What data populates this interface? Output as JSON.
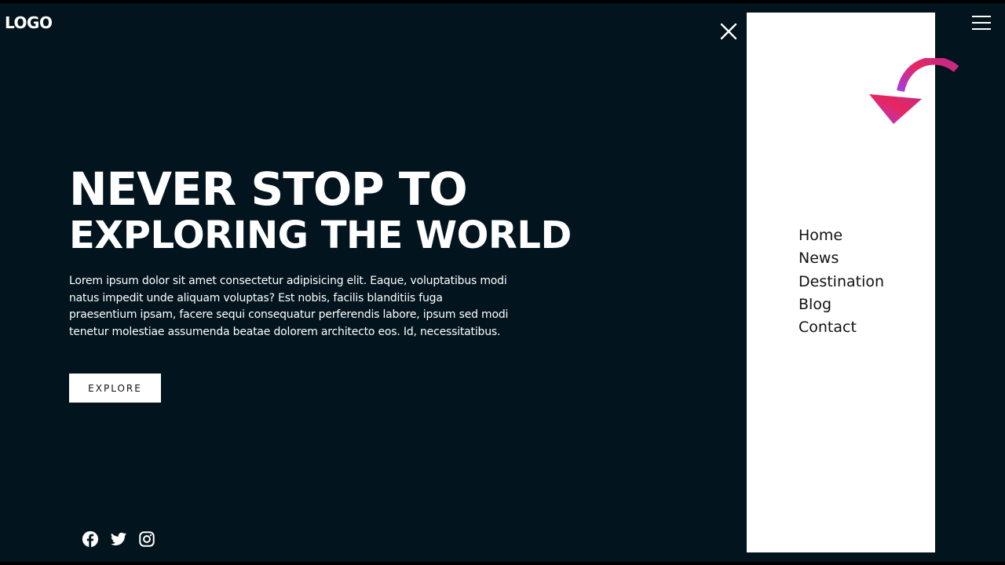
{
  "header": {
    "logo": "LOGO"
  },
  "hero": {
    "title_line1": "NEVER STOP TO",
    "title_line2": "EXPLORING THE WORLD",
    "description": "Lorem ipsum dolor sit amet consectetur adipisicing elit. Eaque, voluptatibus modi natus impedit unde aliquam voluptas? Est nobis, facilis blanditiis fuga praesentium ipsam, facere sequi consequatur perferendis labore, ipsum sed modi tenetur molestiae assumenda beatae dolorem architecto eos. Id, necessitatibus.",
    "cta_label": "EXPLORE"
  },
  "social": [
    {
      "icon": "facebook-icon"
    },
    {
      "icon": "twitter-icon"
    },
    {
      "icon": "instagram-icon"
    }
  ],
  "menu": {
    "items": [
      {
        "label": "Home"
      },
      {
        "label": "News"
      },
      {
        "label": "Destination"
      },
      {
        "label": "Blog"
      },
      {
        "label": "Contact"
      }
    ],
    "close_icon": "close-icon",
    "toggle_icon": "hamburger-menu-icon"
  },
  "colors": {
    "page_background": "#02141d",
    "text_primary": "#ffffff",
    "menu_background": "#ffffff",
    "menu_text": "#111111",
    "annotation_arrow_start": "#e8265e",
    "annotation_arrow_end": "#a43be0"
  }
}
